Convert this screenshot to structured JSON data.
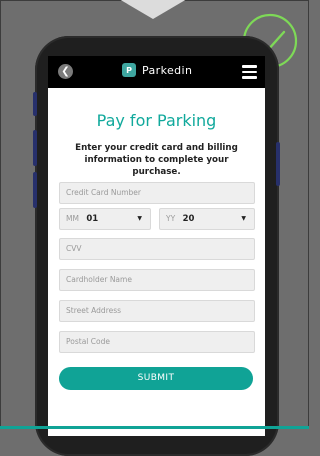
{
  "colors": {
    "accent": "#10a396",
    "badge": "#7ed957",
    "header": "#000000"
  },
  "app": {
    "name": "Parkedin",
    "logo_icon": "parking-p-icon"
  },
  "page": {
    "title": "Pay for Parking",
    "subtitle": "Enter your credit card and billing information to complete your purchase."
  },
  "form": {
    "card_number": {
      "placeholder": "Credit Card Number",
      "value": ""
    },
    "month": {
      "label": "MM",
      "value": "01"
    },
    "year": {
      "label": "YY",
      "value": "20"
    },
    "cvv": {
      "placeholder": "CVV",
      "value": ""
    },
    "cardholder": {
      "placeholder": "Cardholder Name",
      "value": ""
    },
    "street": {
      "placeholder": "Street Address",
      "value": ""
    },
    "postal": {
      "placeholder": "Postal Code",
      "value": ""
    },
    "submit_label": "SUBMIT"
  },
  "icons": {
    "back": "chevron-left-icon",
    "menu": "hamburger-menu-icon",
    "badge": "check-circle-icon",
    "caret": "caret-down-icon"
  }
}
